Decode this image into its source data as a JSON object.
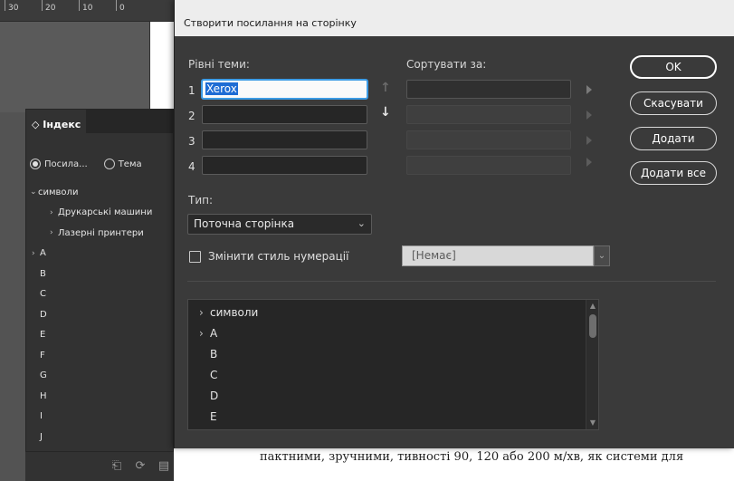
{
  "ruler": {
    "labels": [
      "30",
      "20",
      "10",
      "0"
    ]
  },
  "index_panel": {
    "tab_title": "◇ Індекс",
    "radio_refs": "Посила...",
    "radio_topic": "Тема",
    "items": [
      {
        "label": "символи",
        "expanded": true
      },
      {
        "label": "Друкарські машини"
      },
      {
        "label": "Лазерні принтери"
      },
      {
        "label": "A"
      },
      {
        "label": "B"
      },
      {
        "label": "C"
      },
      {
        "label": "D"
      },
      {
        "label": "E"
      },
      {
        "label": "F"
      },
      {
        "label": "G"
      },
      {
        "label": "H"
      },
      {
        "label": "I"
      },
      {
        "label": "J"
      }
    ]
  },
  "document": {
    "text": "пактними, зручними,   тивності 90, 120 або 200 м/хв, як   системи для"
  },
  "dialog": {
    "title": "Створити посилання на сторінку",
    "topic_levels_label": "Рівні теми:",
    "sort_by_label": "Сортувати за:",
    "levels": [
      {
        "num": "1",
        "value": "Xerox"
      },
      {
        "num": "2",
        "value": ""
      },
      {
        "num": "3",
        "value": ""
      },
      {
        "num": "4",
        "value": ""
      }
    ],
    "buttons": {
      "ok": "OK",
      "cancel": "Скасувати",
      "add": "Додати",
      "add_all": "Додати все"
    },
    "type_label": "Тип:",
    "type_value": "Поточна сторінка",
    "change_numbering_label": "Змінити стиль нумерації",
    "numbering_style_value": "[Немає]",
    "topic_list": [
      {
        "label": "символи",
        "chevron": true
      },
      {
        "label": "A",
        "chevron": true
      },
      {
        "label": "B",
        "chevron": false
      },
      {
        "label": "C",
        "chevron": false
      },
      {
        "label": "D",
        "chevron": false
      },
      {
        "label": "E",
        "chevron": false
      }
    ]
  },
  "colors": {
    "focus_blue": "#3c9be5",
    "selection_blue": "#1e6cd4",
    "dialog_bg": "#3a3a3a",
    "panel_bg": "#323232"
  }
}
